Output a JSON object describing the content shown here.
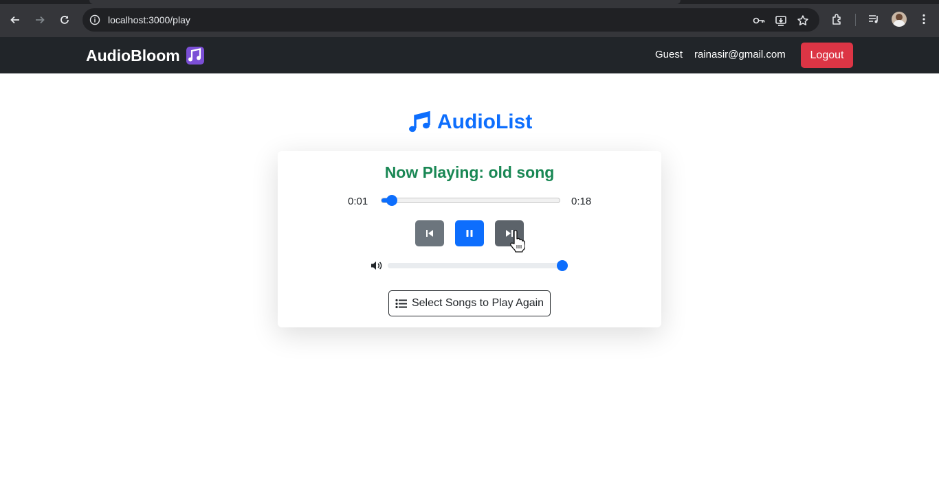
{
  "browser": {
    "url": "localhost:3000/play"
  },
  "navbar": {
    "brand": "AudioBloom",
    "user_role": "Guest",
    "email": "rainasir@gmail.com",
    "logout_label": "Logout"
  },
  "page": {
    "title": "AudioList"
  },
  "player": {
    "now_playing": "Now Playing: old song",
    "current_time": "0:01",
    "total_time": "0:18",
    "progress_fraction": 0.06,
    "volume_fraction": 1.0,
    "select_button_label": "Select Songs to Play Again"
  },
  "colors": {
    "accent": "#0d6efd",
    "now_playing": "#198754",
    "danger": "#dc3545",
    "navbar": "#212529"
  }
}
